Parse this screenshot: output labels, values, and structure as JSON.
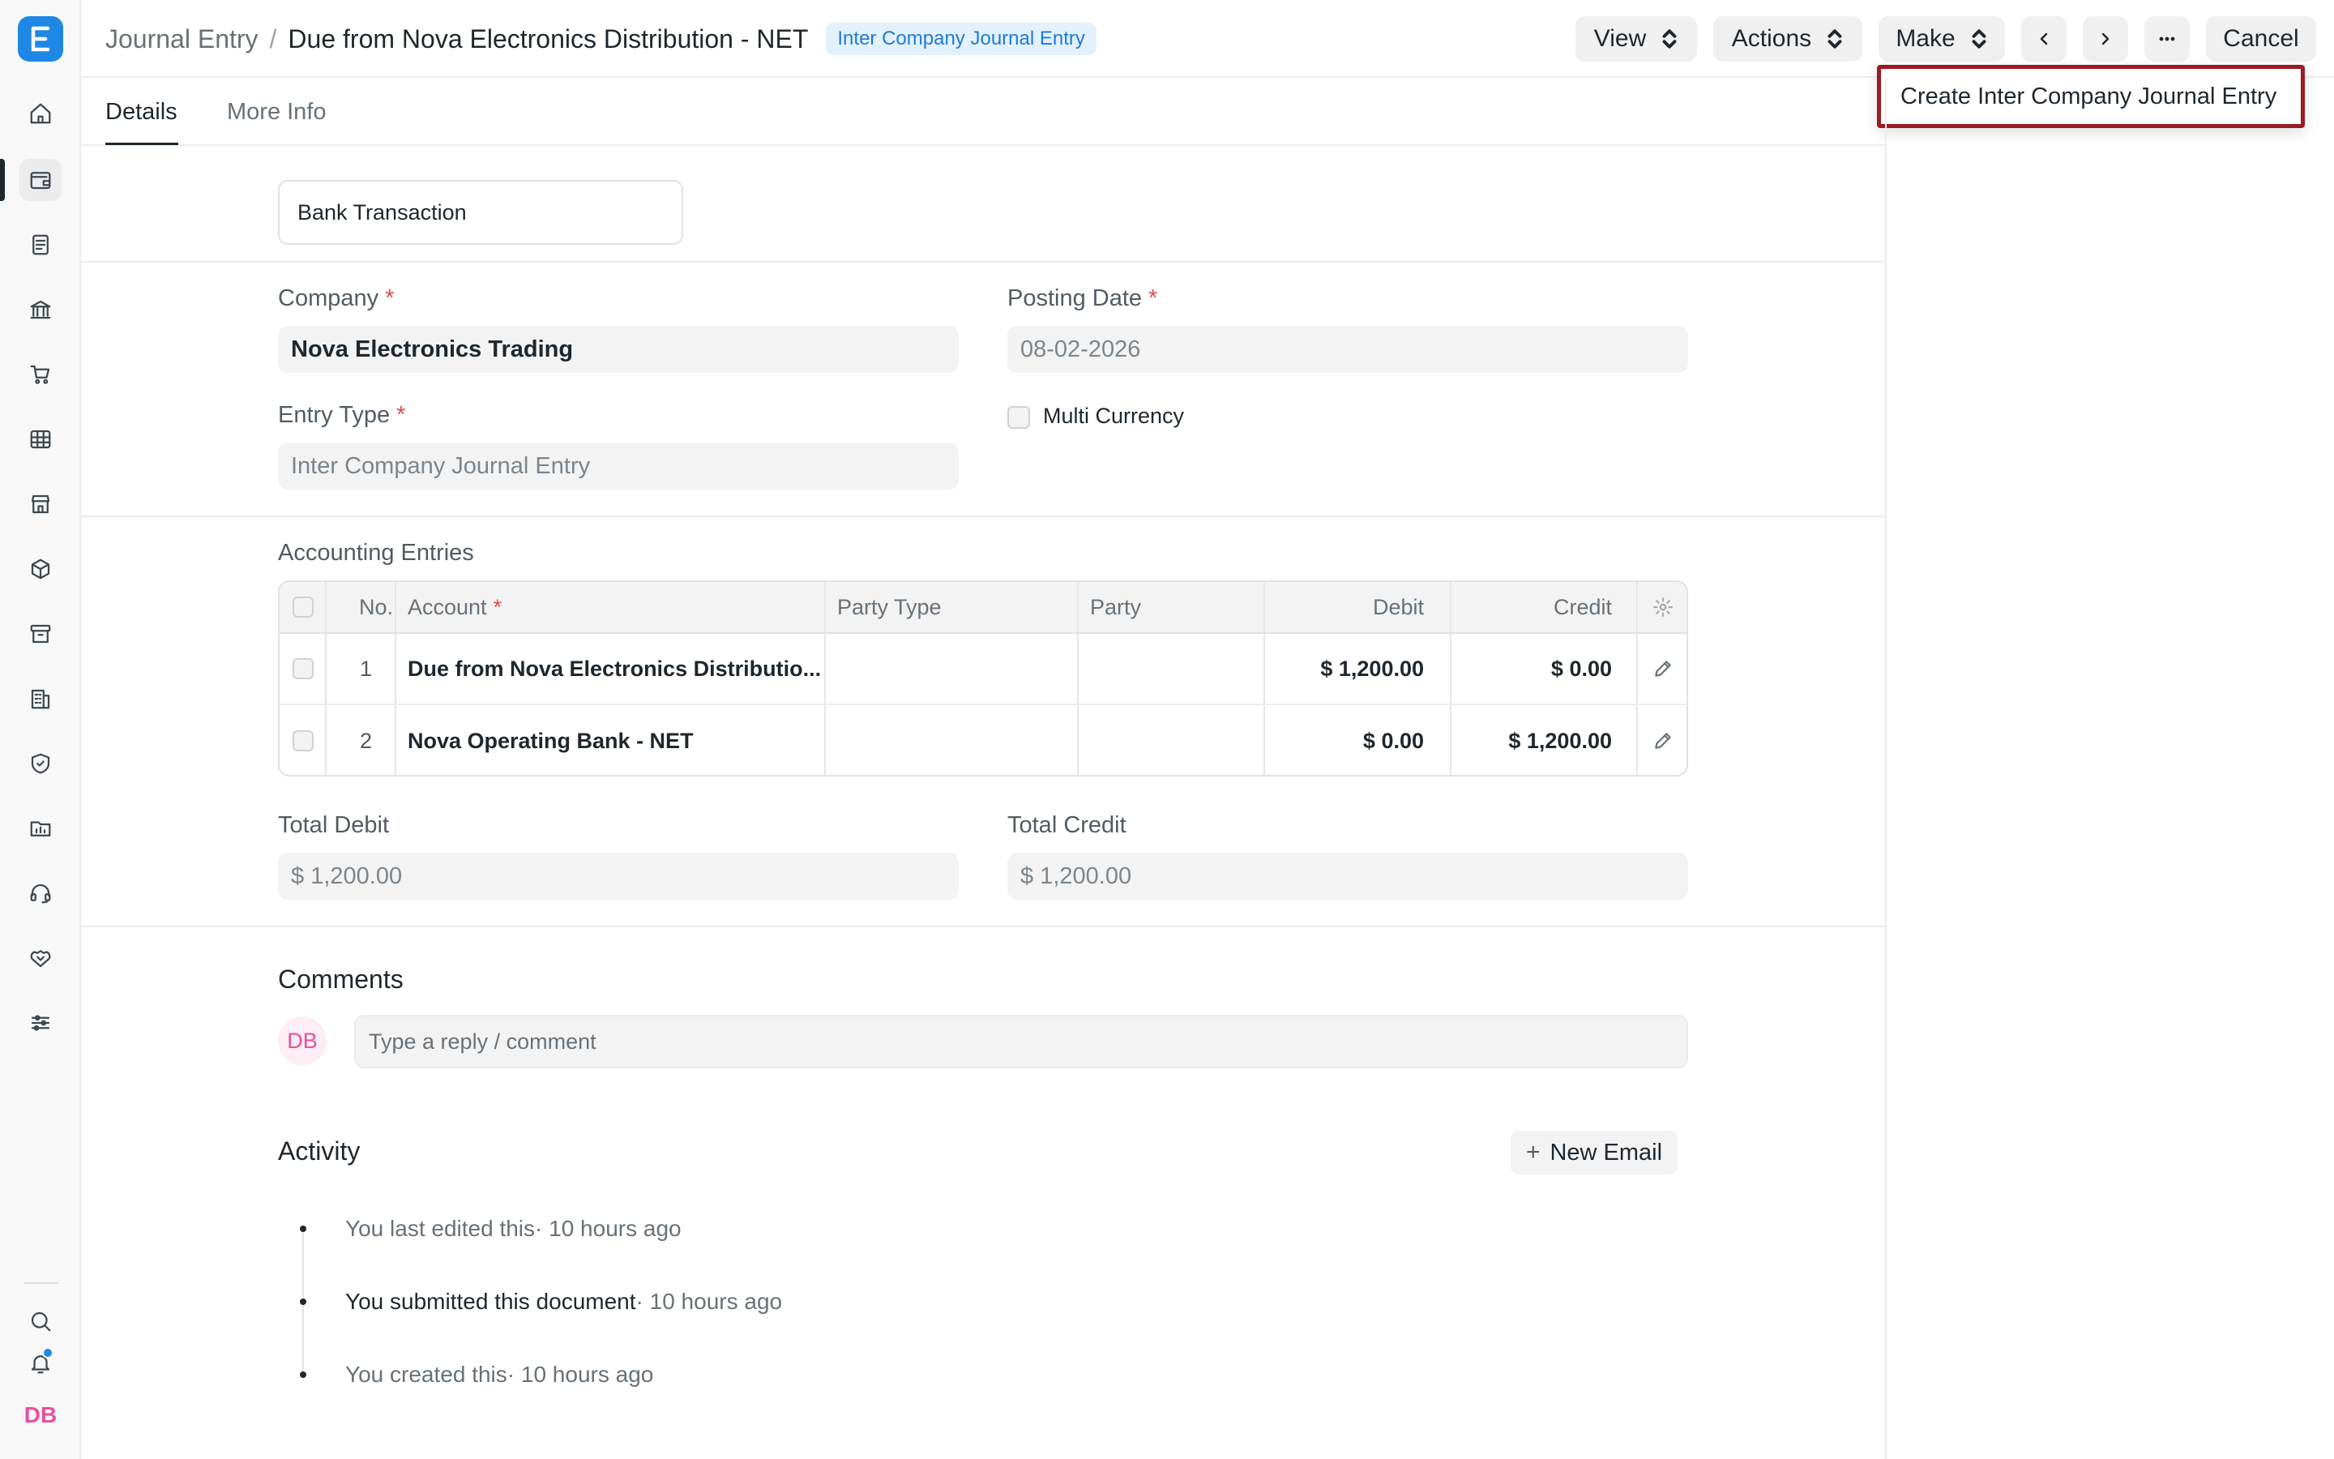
{
  "breadcrumb": {
    "parent": "Journal Entry",
    "separator": "/",
    "title": "Due from Nova Electronics Distribution - NET",
    "badge": "Inter Company Journal Entry"
  },
  "header_buttons": {
    "view": "View",
    "actions": "Actions",
    "make": "Make",
    "cancel": "Cancel"
  },
  "dropdown": {
    "item": "Create Inter Company Journal Entry"
  },
  "tabs": [
    {
      "label": "Details",
      "active": true
    },
    {
      "label": "More Info",
      "active": false
    }
  ],
  "form": {
    "bank_transaction": "Bank Transaction",
    "company_label": "Company",
    "company_value": "Nova Electronics Trading",
    "posting_date_label": "Posting Date",
    "posting_date_value": "08-02-2026",
    "entry_type_label": "Entry Type",
    "entry_type_value": "Inter Company Journal Entry",
    "multi_currency_label": "Multi Currency",
    "required_mark": "*"
  },
  "accounting": {
    "section_label": "Accounting Entries",
    "columns": {
      "no": "No.",
      "account": "Account",
      "party_type": "Party Type",
      "party": "Party",
      "debit": "Debit",
      "credit": "Credit"
    },
    "rows": [
      {
        "no": "1",
        "account": "Due from Nova Electronics Distributio...",
        "party_type": "",
        "party": "",
        "debit": "$ 1,200.00",
        "credit": "$ 0.00"
      },
      {
        "no": "2",
        "account": "Nova Operating Bank - NET",
        "party_type": "",
        "party": "",
        "debit": "$ 0.00",
        "credit": "$ 1,200.00"
      }
    ]
  },
  "totals": {
    "debit_label": "Total Debit",
    "debit_value": "$ 1,200.00",
    "credit_label": "Total Credit",
    "credit_value": "$ 1,200.00"
  },
  "comments": {
    "title": "Comments",
    "avatar": "DB",
    "placeholder": "Type a reply / comment"
  },
  "activity": {
    "title": "Activity",
    "new_email": "New Email",
    "items": [
      {
        "text": "You last edited this",
        "time": " · 10 hours ago"
      },
      {
        "text": "You submitted this document",
        "time": " · 10 hours ago"
      },
      {
        "text": "You created this",
        "time": " · 10 hours ago"
      }
    ]
  },
  "sidebar": {
    "user_initials": "DB"
  },
  "colors": {
    "brand": "#1e88e5",
    "highlight_border": "#9b1b24",
    "required": "#e24c4c",
    "avatar_pink": "#e84fa1"
  }
}
